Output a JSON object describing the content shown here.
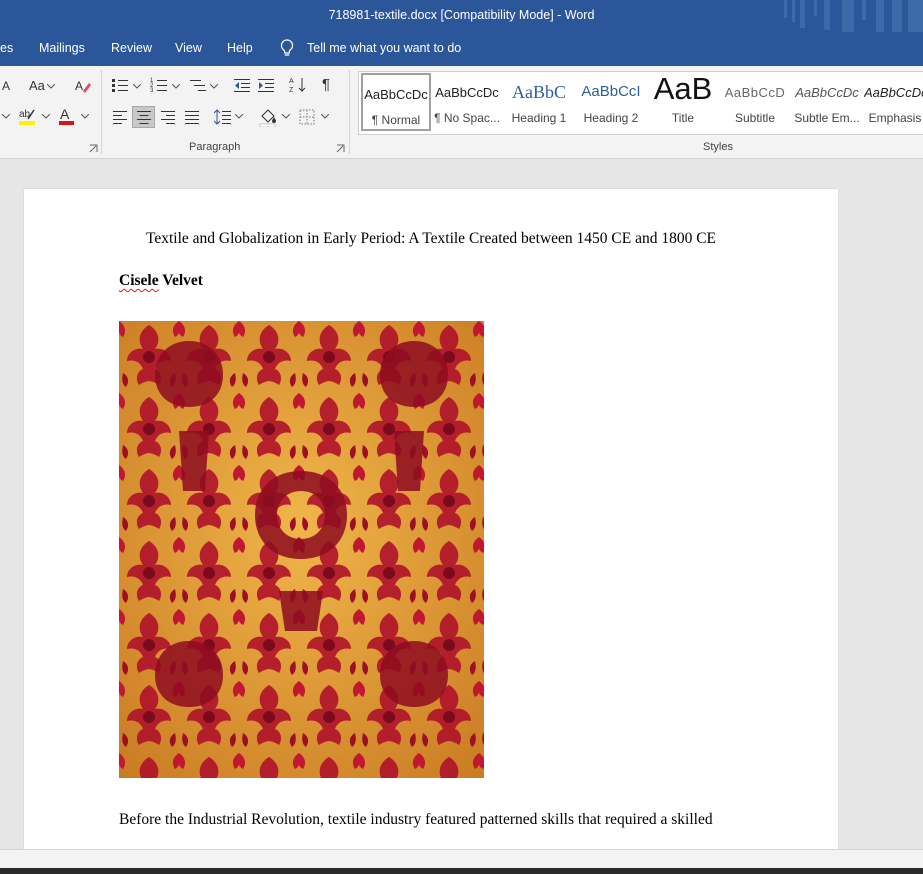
{
  "window": {
    "title": "718981-textile.docx [Compatibility Mode]  -  Word"
  },
  "tabs": [
    {
      "label": "es"
    },
    {
      "label": "Mailings"
    },
    {
      "label": "Review"
    },
    {
      "label": "View"
    },
    {
      "label": "Help"
    }
  ],
  "tell_me": {
    "label": "Tell me what you want to do"
  },
  "ribbon": {
    "font_group": {
      "case_label": "Aa",
      "grow_label": "A"
    },
    "paragraph_group": {
      "label": "Paragraph"
    },
    "styles_group": {
      "label": "Styles",
      "items": [
        {
          "preview": "AaBbCcDc",
          "name": "¶ Normal"
        },
        {
          "preview": "AaBbCcDc",
          "name": "¶ No Spac..."
        },
        {
          "preview": "AaBbC",
          "name": "Heading 1"
        },
        {
          "preview": "AaBbCcI",
          "name": "Heading 2"
        },
        {
          "preview": "AaB",
          "name": "Title"
        },
        {
          "preview": "AaBbCcD",
          "name": "Subtitle"
        },
        {
          "preview": "AaBbCcDc",
          "name": "Subtle Em..."
        },
        {
          "preview": "AaBbCcDc",
          "name": "Emphasis"
        }
      ]
    }
  },
  "document": {
    "title": "Textile and Globalization in Early Period: A Textile Created between 1450 CE and 1800 CE",
    "heading_word1": "Cisele",
    "heading_word2": " Velvet",
    "paragraph": "Before the Industrial Revolution, textile industry featured patterned skills that required a skilled"
  },
  "colors": {
    "accent": "#2b579a",
    "ribbon_bg": "#f3f3f3",
    "canvas": "#e6e6e6",
    "textile_red": "#b0122a",
    "textile_gold": "#e8a33a"
  }
}
